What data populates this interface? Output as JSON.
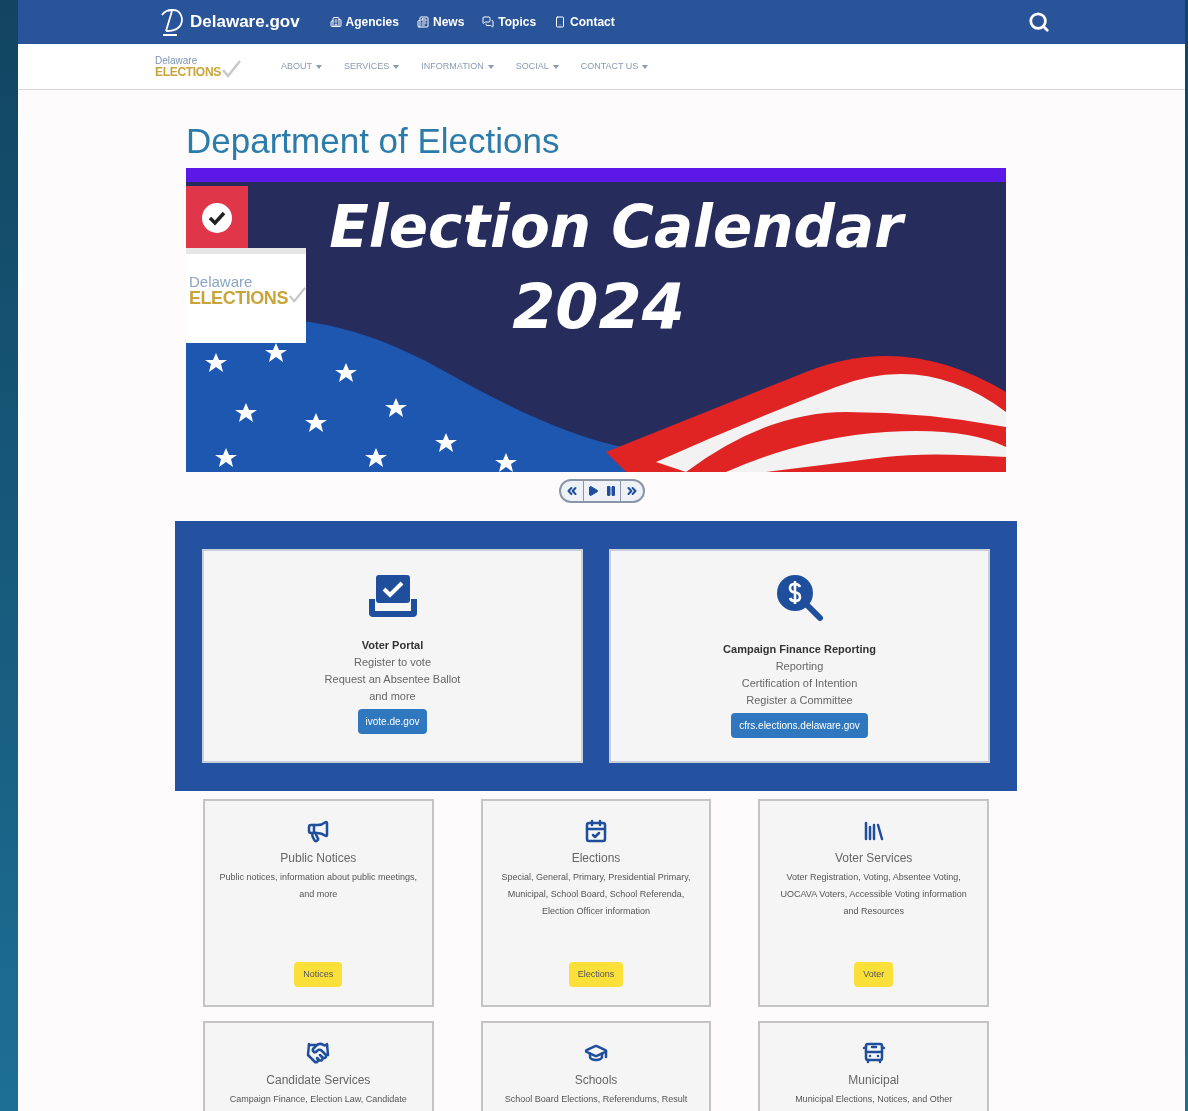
{
  "top_bar": {
    "site": "Delaware.gov",
    "links": [
      {
        "kind": "agencies",
        "label": "Agencies"
      },
      {
        "kind": "news",
        "label": "News"
      },
      {
        "kind": "topics",
        "label": "Topics"
      },
      {
        "kind": "contact",
        "label": "Contact"
      }
    ]
  },
  "sub_nav": {
    "logo_top": "Delaware",
    "logo_bottom": "ELECTIONS",
    "items": [
      "ABOUT",
      "SERVICES",
      "INFORMATION",
      "SOCIAL",
      "CONTACT US"
    ]
  },
  "heading": "Department of Elections",
  "banner": {
    "title": "Election Calendar",
    "year": "2024",
    "logo_top": "Delaware",
    "logo_bottom": "ELECTIONS"
  },
  "featured": [
    {
      "kind": "ballot",
      "title": "Voter Portal",
      "lines": [
        "Register to vote",
        "Request an Absentee Ballot",
        "and more"
      ],
      "button": "ivote.de.gov"
    },
    {
      "kind": "finance",
      "title": "Campaign Finance Reporting",
      "lines": [
        "Reporting",
        "Certification of Intention",
        "Register a Committee"
      ],
      "button": "cfrs.elections.delaware.gov"
    }
  ],
  "services": [
    {
      "kind": "megaphone",
      "title": "Public Notices",
      "description": "Public notices, information about public meetings, and more",
      "button": "Notices"
    },
    {
      "kind": "calendar",
      "title": "Elections",
      "description": "Special, General, Primary, Presidential Primary, Municipal, School Board, School Referenda, Election Officer information",
      "button": "Elections"
    },
    {
      "kind": "voter",
      "title": "Voter Services",
      "description": "Voter Registration, Voting, Absentee Voting, UOCAVA Voters, Accessible Voting information and Resources",
      "button": "Voter"
    },
    {
      "kind": "handshake",
      "title": "Candidate Services",
      "description": "Campaign Finance, Election Law, Candidate"
    },
    {
      "kind": "school",
      "title": "Schools",
      "description": "School Board Elections, Referendums, Result"
    },
    {
      "kind": "bus",
      "title": "Municipal",
      "description": "Municipal Elections, Notices, and Other"
    }
  ]
}
